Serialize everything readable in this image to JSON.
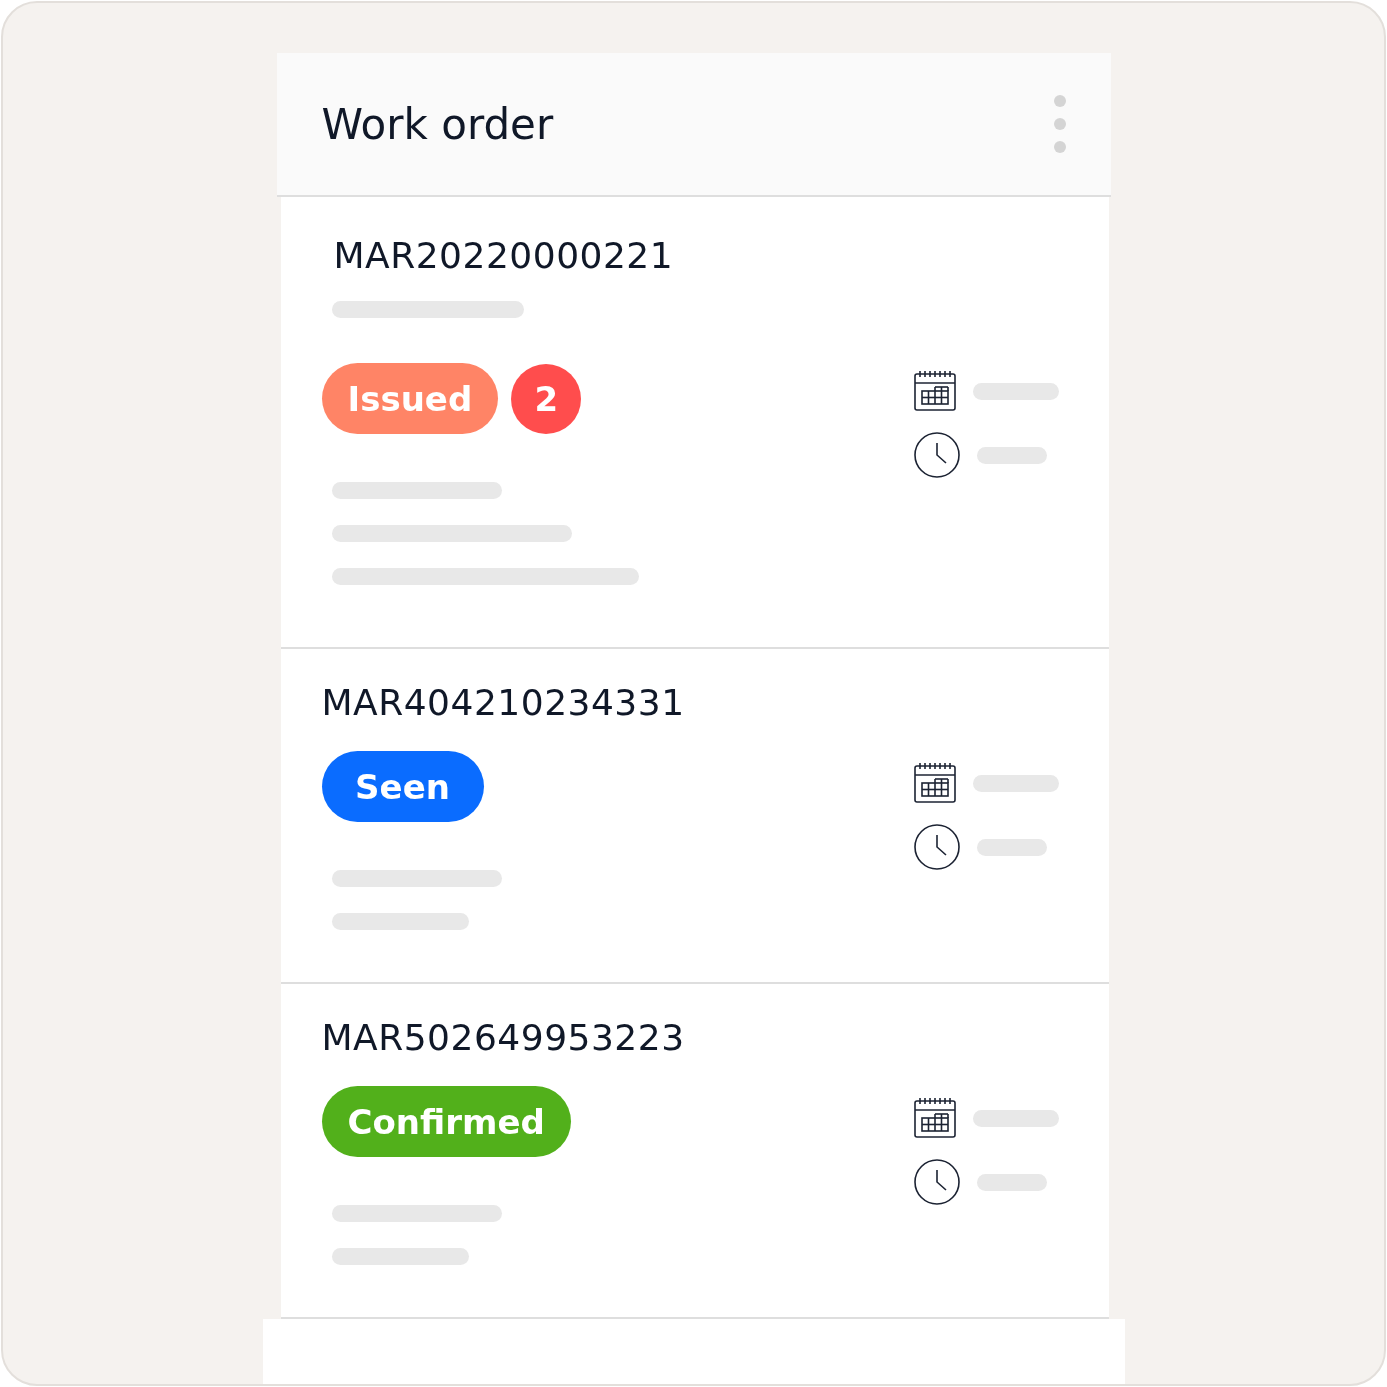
{
  "header": {
    "title": "Work order"
  },
  "orders": [
    {
      "number": "MAR20220000221",
      "status": "Issued",
      "color": "#ff8466",
      "count": "2"
    },
    {
      "number": "MAR404210234331",
      "status": "Seen",
      "color": "#0a6cff"
    },
    {
      "number": "MAR502649953223",
      "status": "Confirmed",
      "color": "#52b01b"
    }
  ]
}
